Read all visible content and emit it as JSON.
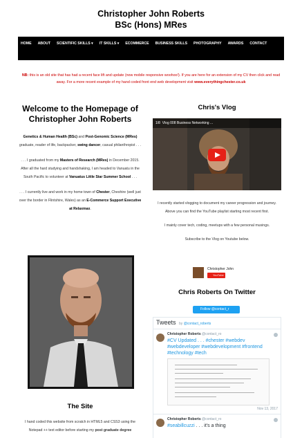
{
  "header": {
    "line1": "Christopher John Roberts",
    "line2": "BSc (Hons) MRes"
  },
  "nav": {
    "items": [
      "Home",
      "About",
      "Scientific Skills",
      "IT Skills",
      "Ecommerce",
      "Business Skills",
      "Photography",
      "Awards",
      "Contact"
    ]
  },
  "notice": {
    "prefix": "NB:",
    "text": "this is an old site that has had a recent face lift and update (now mobile responsive woohoo!). If you are here for an extension of my CV then click and read away. For a more recent example of my hand coded front end web development visit",
    "link": "www.everythingchester.co.uk"
  },
  "welcome": {
    "title": "Welcome to the Homepage of Christopher John Roberts",
    "p1_b1": "Genetics & Human Health (BSc)",
    "p1_mid": "and",
    "p1_b2": "Post-Genomic Science (MRes)",
    "p1_rest": "graduate, reader of life, backpacker,",
    "p1_b3": "swing dancer",
    "p1_end": ", casual philanthropist . . .",
    "p2_start": ". . . I graduated from my",
    "p2_b1": "Masters of Research (MRes)",
    "p2_mid": "in December 2015. After all the hard studying and handshaking, I am headed to Vanuatu in the South Pacific to volunteer at",
    "p2_b2": "Vanuatus Little Star Summer School",
    "p2_end": ". . .",
    "p3_start": ". . . I currently live and work in my home town of",
    "p3_b1": "Chester",
    "p3_mid": ", Cheshire (well just over the border in Flintshire, Wales) as an",
    "p3_b2": "E-Commerce Support Executive at Relaxmax",
    "p3_end": "."
  },
  "site": {
    "title": "The Site",
    "text_start": "I hand coded this website from scratch in HTML5 and CSS3 using the Notepad ++ text editor before starting my",
    "text_b": "post graduate degree"
  },
  "vlog": {
    "title": "Chris's Vlog",
    "video_counter": "1/8",
    "video_title": "Vlog 008 Business Networking ...",
    "p1": "I recently started vlogging to document my career progression and journey. Above you can find the YouTube playlist starting most recent first.",
    "p2": "I mainly cover tech, coding, meetups with a few personal musings.",
    "p3": "Subscribe to the Vlog on Youtube below.",
    "channel_name": "Christopher John",
    "subscribe_label": "YouTube"
  },
  "twitter": {
    "title": "Chris Roberts On Twitter",
    "follow_label": "Follow @contact_r",
    "widget_title": "Tweets",
    "widget_by": "by",
    "widget_handle": "@contact_roberts",
    "tweet1_name": "Christopher Roberts",
    "tweet1_handle": "@contact_ro",
    "tweet1_text": "#CV Updated . . . #chester #webdev #webdeveloper #webdevelopment #frontend #technology #tech",
    "tweet1_date": "Nov 13, 2017",
    "tweet2_name": "Christopher Roberts",
    "tweet2_handle": "@contact_ro",
    "tweet2_tag": "#seabillcuzzi",
    "tweet2_rest": ". . . it's a thing"
  }
}
